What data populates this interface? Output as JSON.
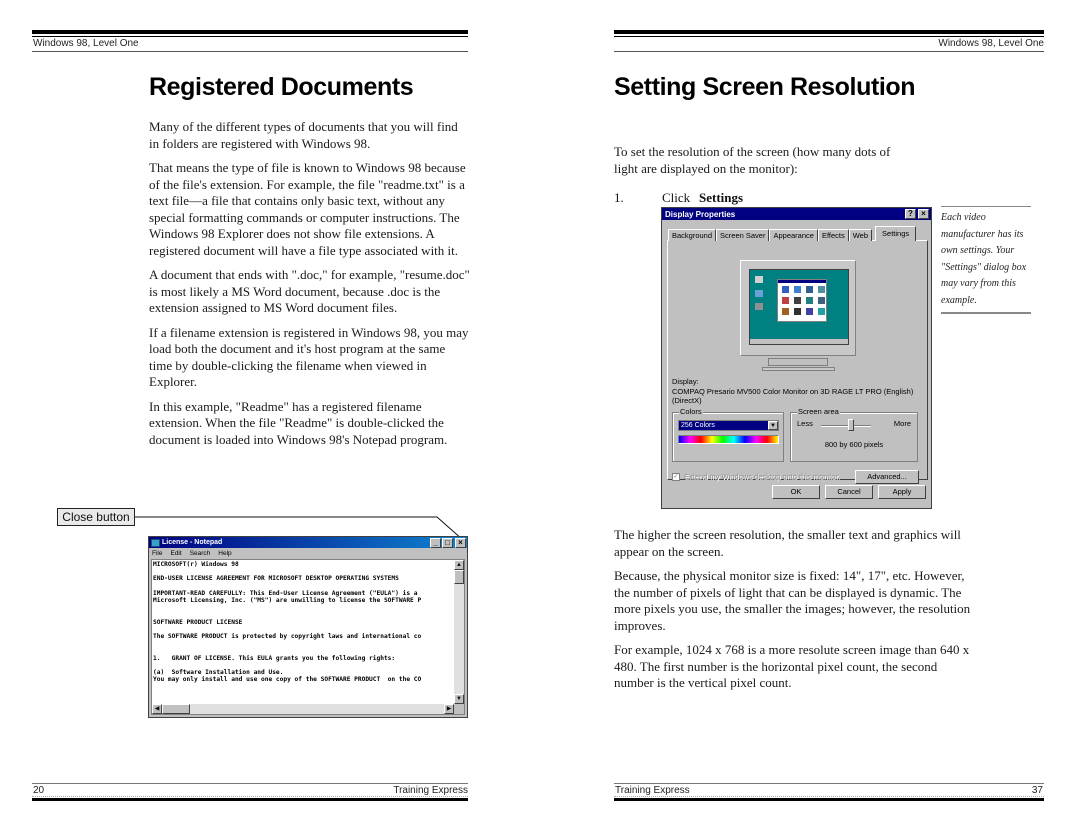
{
  "left_page": {
    "header": "Windows 98, Level One",
    "title": "Registered Documents",
    "paragraphs": [
      "Many of the different types of documents that you will find in folders are registered with Windows 98.",
      "That means the type of file is known to Windows 98 because of the file's extension. For example, the file \"readme.txt\" is a text file—a file that contains only basic text, without any special formatting commands or computer instructions.  The Windows 98 Explorer does not show file extensions.  A registered document will have a file type associated with it.",
      "A document that ends with \".doc,\" for example, \"resume.doc\" is most likely a MS Word document, because .doc is the extension assigned to MS Word document files.",
      "If a filename extension is registered in Windows 98, you may load both the document and it's host program at the same time by double-clicking the filename when viewed in Explorer.",
      "In this example, \"Readme\" has a registered filename extension. When the file \"Readme\" is double-clicked the document is loaded into Windows 98's Notepad program."
    ],
    "callout": "Close button",
    "notepad": {
      "title": "License - Notepad",
      "menu": [
        "File",
        "Edit",
        "Search",
        "Help"
      ],
      "lines": [
        "MICROSOFT(r) Windows 98",
        "",
        "END-USER LICENSE AGREEMENT FOR MICROSOFT DESKTOP OPERATING SYSTEMS",
        "",
        "IMPORTANT-READ CAREFULLY: This End-User License Agreement (\"EULA\") is a",
        "Microsoft Licensing, Inc. (\"MS\") are unwilling to license the SOFTWARE P",
        "",
        "",
        "SOFTWARE PRODUCT LICENSE",
        "",
        "The SOFTWARE PRODUCT is protected by copyright laws and international co",
        "",
        "",
        "1.   GRANT OF LICENSE. This EULA grants you the following rights:",
        "",
        "(a)  Software Installation and Use.",
        "You may only install and use one copy of the SOFTWARE PRODUCT  on the CO"
      ],
      "buttons": {
        "minimize": "_",
        "maximize": "□",
        "close": "×"
      }
    },
    "footer": {
      "page_number": "20",
      "publisher": "Training Express"
    }
  },
  "right_page": {
    "header": "Windows 98, Level One",
    "title": "Setting Screen Resolution",
    "intro": "To set the resolution of the screen (how many dots of light are displayed on the monitor):",
    "step": {
      "number": "1.",
      "verb": "Click",
      "target": "Settings"
    },
    "dialog": {
      "title": "Display Properties",
      "help_button": "?",
      "close_button": "×",
      "tabs": [
        "Background",
        "Screen Saver",
        "Appearance",
        "Effects",
        "Web",
        "Settings"
      ],
      "active_tab": "Settings",
      "display_label": "Display:",
      "display_value": "COMPAQ Presario MV500 Color Monitor on 3D RAGE LT PRO (English) (DirectX)",
      "colors_label": "Colors",
      "colors_value": "256 Colors",
      "screen_area_label": "Screen area",
      "less_label": "Less",
      "more_label": "More",
      "resolution_value": "800 by 600 pixels",
      "slider_position": 0.6,
      "extend_label": "Extend my Windows desktop onto this monitor.",
      "extend_checked": true,
      "advanced_button": "Advanced...",
      "ok_button": "OK",
      "cancel_button": "Cancel",
      "apply_button": "Apply"
    },
    "margin_note": "Each video manufacturer has its own settings. Your \"Settings\" dialog box may vary from this example.",
    "paragraphs": [
      "The higher the screen resolution, the smaller text and graphics will appear on the screen.",
      "Because, the physical monitor size is fixed: 14\", 17\", etc. However, the number of pixels of light that can be displayed is dynamic. The more pixels you use, the smaller the images; however, the resolution improves.",
      "For example, 1024 x 768 is a more resolute screen image than 640 x 480. The first number is the horizontal pixel count, the second number is the vertical pixel count."
    ],
    "footer": {
      "publisher": "Training Express",
      "page_number": "37"
    }
  }
}
